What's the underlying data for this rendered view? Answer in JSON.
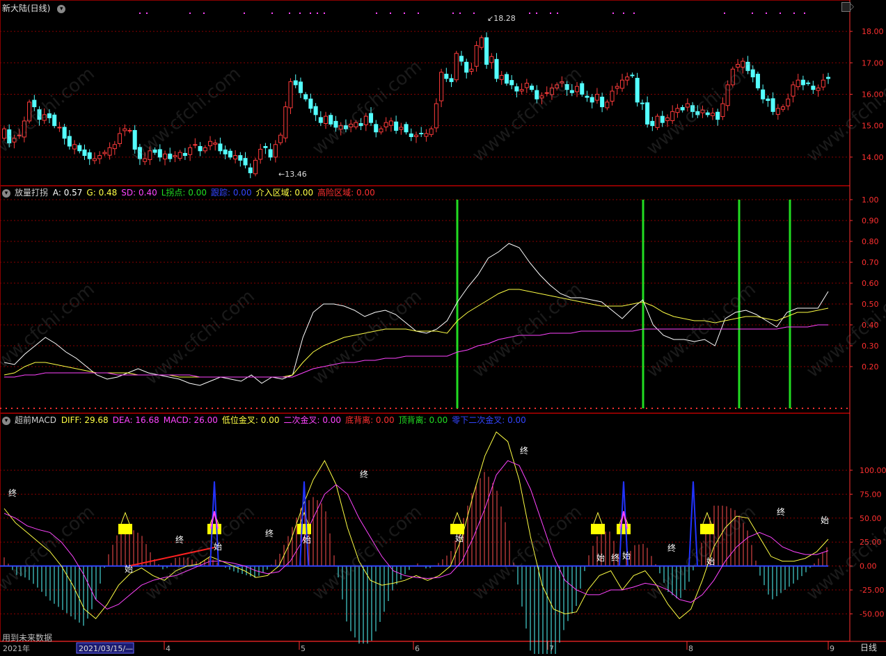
{
  "price_panel": {
    "title": "新大陆(日线)",
    "high_mark": "18.28",
    "low_mark": "13.46"
  },
  "ind1_header": {
    "name": "放量打拐",
    "items": [
      {
        "label": "A: 0.57",
        "color": "#ffffff"
      },
      {
        "label": "G: 0.48",
        "color": "#ffff44"
      },
      {
        "label": "SD: 0.40",
        "color": "#ff44ff"
      },
      {
        "label": "L拐点: 0.00",
        "color": "#22dd22"
      },
      {
        "label": "跟踪: 0.00",
        "color": "#3344ff"
      },
      {
        "label": "介入区域: 0.00",
        "color": "#ffff44"
      },
      {
        "label": "高险区域: 0.00",
        "color": "#ff3030"
      }
    ]
  },
  "ind2_header": {
    "name": "超前MACD",
    "items": [
      {
        "label": "DIFF: 29.68",
        "color": "#ffff44"
      },
      {
        "label": "DEA: 16.68",
        "color": "#ff44ff"
      },
      {
        "label": "MACD: 26.00",
        "color": "#ff44ff"
      },
      {
        "label": "低位金叉: 0.00",
        "color": "#ffff44"
      },
      {
        "label": "二次金叉: 0.00",
        "color": "#ff44ff"
      },
      {
        "label": "底背离: 0.00",
        "color": "#ff3030"
      },
      {
        "label": "顶背离: 0.00",
        "color": "#22dd22"
      },
      {
        "label": "零下二次金叉: 0.00",
        "color": "#3344ff"
      }
    ]
  },
  "markers": {
    "start": "始",
    "end": "终"
  },
  "footer": {
    "note": "用到未来数据",
    "year": "2021年",
    "cursor_date": "2021/03/15/—",
    "months": [
      "4",
      "5",
      "6",
      "7",
      "8",
      "9"
    ],
    "period": "日线"
  },
  "watermark": "www.cfchi.com",
  "colors": {
    "up": "#ff3b3b",
    "down": "#54ffff",
    "grid": "#8a0000",
    "axis": "#ff3030"
  },
  "chart_data": [
    {
      "type": "candlestick",
      "title": "新大陆(日线)",
      "y_ticks": [
        18.0,
        17.0,
        16.0,
        15.0,
        14.0
      ],
      "ylim": [
        13.2,
        18.6
      ],
      "x_months": [
        "4",
        "5",
        "6",
        "7",
        "8",
        "9"
      ],
      "close": [
        14.9,
        14.45,
        14.6,
        14.7,
        15.15,
        15.75,
        15.6,
        15.2,
        15.35,
        15.25,
        15.0,
        14.95,
        14.6,
        14.35,
        14.4,
        14.2,
        14.05,
        13.95,
        13.95,
        14.05,
        14.15,
        14.3,
        14.4,
        14.75,
        14.9,
        14.85,
        14.25,
        13.95,
        13.95,
        14.2,
        14.15,
        14.0,
        14.1,
        13.95,
        14.05,
        14.15,
        14.05,
        14.3,
        14.4,
        14.2,
        14.3,
        14.5,
        14.45,
        14.2,
        14.1,
        14.0,
        14.05,
        13.9,
        13.75,
        13.5,
        13.9,
        14.25,
        14.3,
        14.0,
        14.4,
        14.7,
        15.6,
        16.4,
        16.3,
        16.05,
        15.85,
        15.55,
        15.35,
        15.1,
        15.3,
        15.05,
        14.95,
        15.0,
        14.9,
        15.05,
        15.1,
        15.0,
        15.3,
        15.1,
        14.8,
        14.9,
        15.1,
        15.15,
        14.85,
        14.95,
        14.8,
        14.65,
        14.7,
        14.75,
        14.75,
        14.9,
        15.7,
        16.7,
        16.5,
        16.4,
        17.3,
        17.05,
        16.7,
        16.8,
        17.55,
        17.8,
        16.95,
        17.2,
        16.5,
        16.6,
        16.35,
        16.3,
        16.1,
        16.15,
        16.35,
        16.15,
        15.85,
        15.95,
        16.05,
        16.2,
        16.3,
        16.4,
        16.15,
        16.05,
        16.25,
        16.0,
        15.9,
        15.75,
        16.0,
        15.6,
        15.75,
        16.1,
        16.25,
        16.45,
        16.55,
        16.6,
        15.75,
        15.7,
        15.05,
        15.0,
        15.3,
        15.1,
        15.25,
        15.45,
        15.55,
        15.5,
        15.7,
        15.45,
        15.35,
        15.5,
        15.35,
        15.4,
        15.2,
        15.7,
        16.3,
        16.8,
        16.95,
        17.05,
        16.75,
        16.55,
        16.2,
        15.85,
        15.8,
        15.45,
        15.55,
        15.6,
        15.85,
        16.3,
        16.45,
        16.3,
        16.35,
        16.15,
        16.2,
        16.45,
        16.5
      ],
      "high_label": 18.28,
      "low_label": 13.46
    },
    {
      "type": "line",
      "title": "放量打拐",
      "y_ticks": [
        1.0,
        0.9,
        0.8,
        0.7,
        0.6,
        0.5,
        0.4,
        0.3,
        0.2
      ],
      "ylim": [
        0.0,
        1.0
      ],
      "series": [
        {
          "name": "A",
          "color": "#ffffff",
          "values": [
            0.22,
            0.21,
            0.26,
            0.3,
            0.34,
            0.31,
            0.27,
            0.24,
            0.2,
            0.16,
            0.14,
            0.15,
            0.17,
            0.19,
            0.17,
            0.16,
            0.15,
            0.14,
            0.12,
            0.11,
            0.13,
            0.15,
            0.14,
            0.13,
            0.16,
            0.12,
            0.15,
            0.14,
            0.16,
            0.34,
            0.46,
            0.5,
            0.5,
            0.49,
            0.47,
            0.44,
            0.46,
            0.47,
            0.45,
            0.41,
            0.37,
            0.36,
            0.38,
            0.42,
            0.51,
            0.58,
            0.64,
            0.72,
            0.75,
            0.79,
            0.77,
            0.7,
            0.64,
            0.59,
            0.55,
            0.53,
            0.53,
            0.52,
            0.51,
            0.47,
            0.43,
            0.48,
            0.52,
            0.4,
            0.35,
            0.33,
            0.33,
            0.32,
            0.33,
            0.3,
            0.43,
            0.46,
            0.47,
            0.45,
            0.42,
            0.39,
            0.46,
            0.48,
            0.48,
            0.48,
            0.56
          ]
        },
        {
          "name": "G",
          "color": "#ffff44",
          "values": [
            0.16,
            0.17,
            0.2,
            0.22,
            0.22,
            0.21,
            0.2,
            0.19,
            0.18,
            0.17,
            0.17,
            0.17,
            0.17,
            0.16,
            0.16,
            0.16,
            0.16,
            0.15,
            0.15,
            0.15,
            0.15,
            0.15,
            0.15,
            0.15,
            0.15,
            0.15,
            0.15,
            0.15,
            0.16,
            0.22,
            0.27,
            0.3,
            0.32,
            0.34,
            0.35,
            0.36,
            0.37,
            0.38,
            0.38,
            0.38,
            0.37,
            0.37,
            0.37,
            0.36,
            0.42,
            0.46,
            0.49,
            0.52,
            0.55,
            0.57,
            0.57,
            0.56,
            0.55,
            0.54,
            0.53,
            0.52,
            0.51,
            0.5,
            0.49,
            0.49,
            0.49,
            0.5,
            0.51,
            0.49,
            0.46,
            0.44,
            0.43,
            0.42,
            0.42,
            0.41,
            0.42,
            0.43,
            0.44,
            0.44,
            0.43,
            0.42,
            0.44,
            0.46,
            0.46,
            0.47,
            0.48
          ]
        },
        {
          "name": "SD",
          "color": "#ff44ff",
          "values": [
            0.15,
            0.15,
            0.16,
            0.16,
            0.17,
            0.17,
            0.17,
            0.17,
            0.17,
            0.17,
            0.17,
            0.16,
            0.16,
            0.16,
            0.16,
            0.16,
            0.16,
            0.16,
            0.16,
            0.15,
            0.15,
            0.15,
            0.15,
            0.15,
            0.15,
            0.15,
            0.15,
            0.15,
            0.15,
            0.17,
            0.19,
            0.2,
            0.21,
            0.22,
            0.22,
            0.23,
            0.23,
            0.24,
            0.24,
            0.25,
            0.25,
            0.25,
            0.25,
            0.25,
            0.27,
            0.28,
            0.3,
            0.31,
            0.33,
            0.34,
            0.35,
            0.35,
            0.35,
            0.36,
            0.36,
            0.36,
            0.37,
            0.37,
            0.37,
            0.37,
            0.37,
            0.37,
            0.38,
            0.38,
            0.38,
            0.38,
            0.38,
            0.38,
            0.38,
            0.38,
            0.38,
            0.38,
            0.38,
            0.38,
            0.38,
            0.38,
            0.39,
            0.39,
            0.39,
            0.4,
            0.4
          ]
        }
      ],
      "signal_bars_x_months": [
        "6-7",
        "7-8",
        "8",
        "8-9"
      ]
    },
    {
      "type": "line",
      "title": "超前MACD",
      "y_ticks": [
        100.0,
        75.0,
        50.0,
        25.0,
        0.0,
        -25.0,
        -50.0
      ],
      "ylim": [
        -70,
        145
      ],
      "series": [
        {
          "name": "DIFF",
          "color": "#ffff44",
          "values": [
            60,
            45,
            35,
            25,
            15,
            0,
            -20,
            -45,
            -55,
            -40,
            -20,
            -8,
            -2,
            -10,
            -15,
            -5,
            0,
            2,
            10,
            5,
            0,
            -5,
            -12,
            -10,
            0,
            25,
            60,
            90,
            110,
            85,
            40,
            5,
            -15,
            -20,
            -18,
            -15,
            -10,
            -15,
            -10,
            0,
            30,
            75,
            115,
            140,
            130,
            90,
            30,
            -20,
            -45,
            -50,
            -48,
            -25,
            -10,
            -5,
            -25,
            -10,
            -5,
            -20,
            -40,
            -55,
            -45,
            -15,
            20,
            40,
            52,
            50,
            30,
            10,
            5,
            5,
            8,
            15,
            28
          ]
        },
        {
          "name": "DEA",
          "color": "#ff44ff",
          "values": [
            55,
            50,
            42,
            38,
            35,
            25,
            10,
            -10,
            -35,
            -45,
            -40,
            -30,
            -20,
            -15,
            -12,
            -10,
            -5,
            0,
            5,
            5,
            3,
            0,
            -5,
            -8,
            -6,
            5,
            25,
            50,
            75,
            85,
            75,
            50,
            30,
            10,
            -5,
            -10,
            -12,
            -13,
            -12,
            -8,
            5,
            30,
            60,
            95,
            110,
            105,
            80,
            45,
            10,
            -15,
            -25,
            -30,
            -30,
            -25,
            -25,
            -22,
            -18,
            -20,
            -25,
            -35,
            -38,
            -30,
            -15,
            5,
            20,
            30,
            35,
            30,
            20,
            15,
            12,
            12,
            16
          ]
        }
      ]
    }
  ]
}
